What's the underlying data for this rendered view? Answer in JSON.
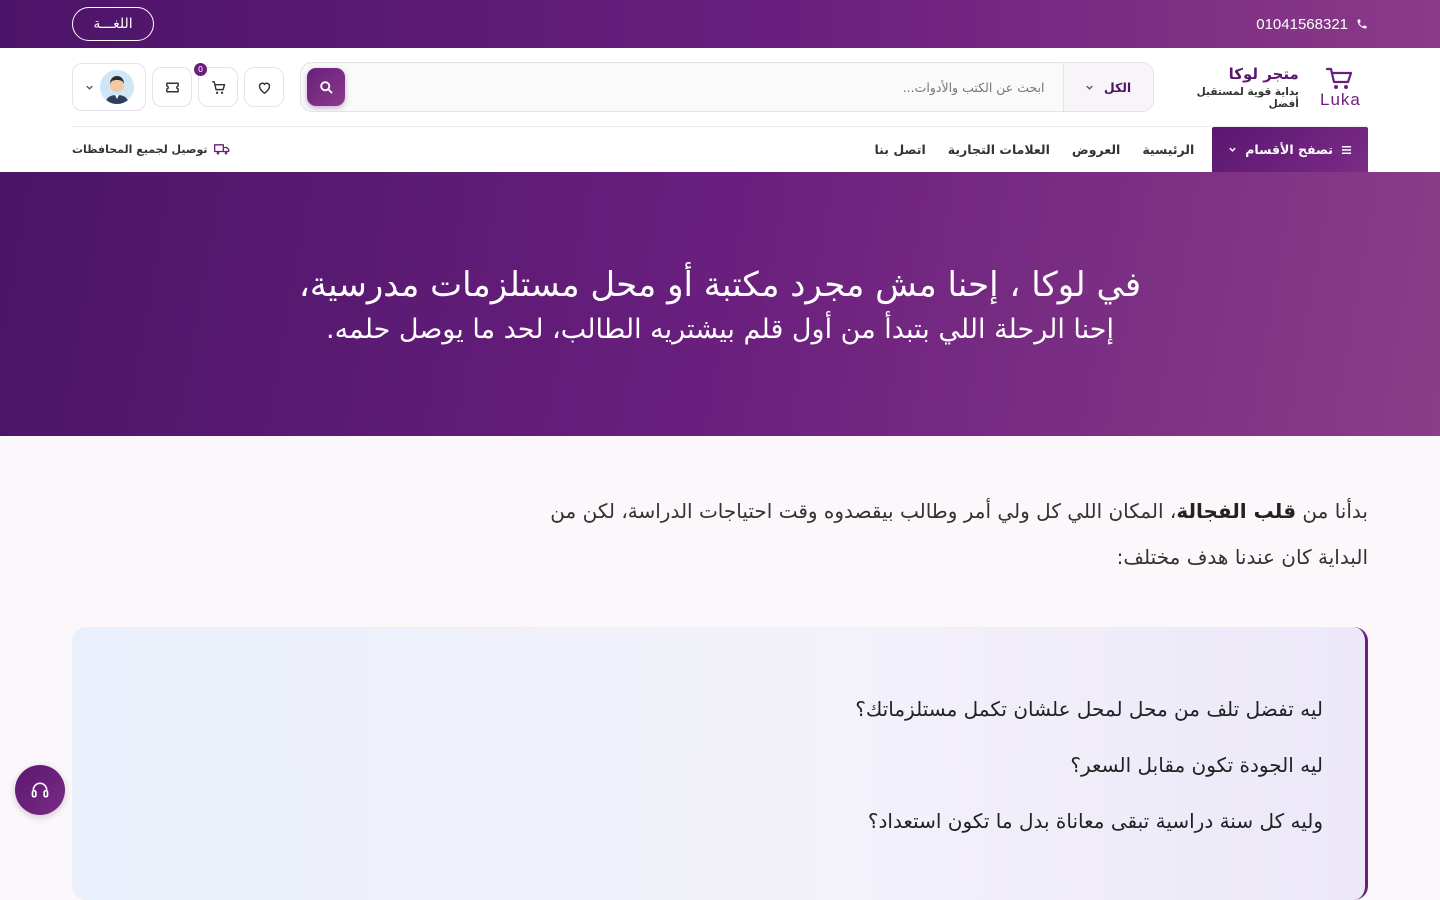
{
  "topbar": {
    "phone": "01041568321",
    "language_label": "اللغـــة"
  },
  "brand": {
    "logo_word": "Luka",
    "name": "متجر لوكا",
    "tagline": "بداية قوية لمستقبل أفضل"
  },
  "search": {
    "category": "الكل",
    "placeholder": "ابحث عن الكتب والأدوات..."
  },
  "header_actions": {
    "cart_count": "0"
  },
  "nav": {
    "browse_label": "تصفح الأقسام",
    "links": [
      "الرئيسية",
      "العروض",
      "العلامات التجارية",
      "اتصل بنا"
    ],
    "delivery": "توصيل لجميع المحافظات"
  },
  "hero": {
    "line1": "في لوكا ، إحنا مش مجرد مكتبة أو محل مستلزمات مدرسية،",
    "line2": "إحنا الرحلة اللي بتبدأ من أول قلم بيشتريه الطالب، لحد ما يوصل حلمه."
  },
  "intro": {
    "before": "بدأنا من ",
    "highlight": "قلب الفجالة",
    "after": "، المكان اللي كل ولي أمر وطالب بيقصدوه وقت احتياجات الدراسة، لكن من البداية كان عندنا هدف مختلف:"
  },
  "questions": [
    "ليه تفضل تلف من محل لمحل علشان تكمل مستلزماتك؟",
    "ليه الجودة تكون مقابل السعر؟",
    "وليه كل سنة دراسية تبقى معاناة بدل ما تكون استعداد؟"
  ],
  "colors": {
    "primary": "#6a1f7e",
    "primary_dark": "#4a1566",
    "accent": "#8a3a88"
  },
  "icons": [
    "phone-icon",
    "search-icon",
    "chevron-down-icon",
    "wishlist-heart-icon",
    "cart-icon",
    "ticket-icon",
    "menu-icon",
    "truck-icon",
    "headset-icon"
  ]
}
